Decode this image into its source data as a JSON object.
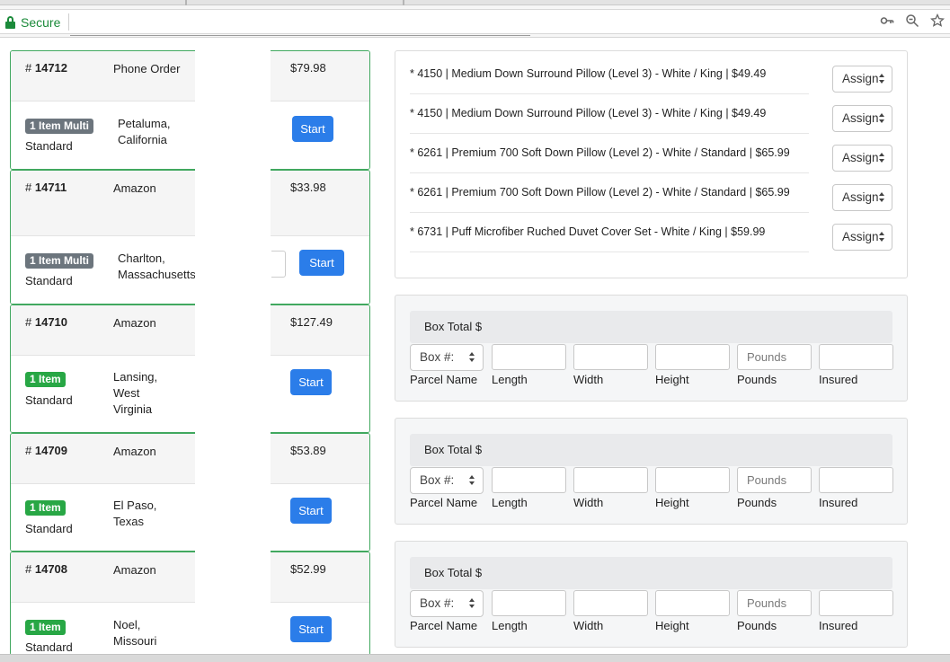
{
  "browser": {
    "secure_label": "Secure",
    "icons": [
      "key-icon",
      "zoom-icon",
      "star-icon"
    ]
  },
  "orders": [
    {
      "number": "14712",
      "channel": "Phone Order",
      "price": "$79.98",
      "badge": "1 Item Multi",
      "badge_kind": "multi",
      "ship": "Standard",
      "location": "Petaluma, California",
      "start": "Start"
    },
    {
      "number": "14711",
      "channel": "Amazon",
      "price": "$33.98",
      "badge": "1 Item Multi",
      "badge_kind": "multi",
      "ship": "Standard",
      "location": "Charlton, Massachusetts",
      "start": "Start"
    },
    {
      "number": "14710",
      "channel": "Amazon",
      "price": "$127.49",
      "badge": "1 Item",
      "badge_kind": "single",
      "ship": "Standard",
      "location": "Lansing, West Virginia",
      "start": "Start"
    },
    {
      "number": "14709",
      "channel": "Amazon",
      "price": "$53.89",
      "badge": "1 Item",
      "badge_kind": "single",
      "ship": "Standard",
      "location": "El Paso, Texas",
      "start": "Start"
    },
    {
      "number": "14708",
      "channel": "Amazon",
      "price": "$52.99",
      "badge": "1 Item",
      "badge_kind": "single",
      "ship": "Standard",
      "location": "Noel, Missouri",
      "start": "Start"
    }
  ],
  "order_number_prefix": "#",
  "items": [
    {
      "text": "* 4150 | Medium Down Surround Pillow (Level 3) - White / King | $49.49",
      "assign": "Assign"
    },
    {
      "text": "* 4150 | Medium Down Surround Pillow (Level 3) - White / King | $49.49",
      "assign": "Assign"
    },
    {
      "text": "* 6261 | Premium 700 Soft Down Pillow (Level 2) - White / Standard | $65.99",
      "assign": "Assign"
    },
    {
      "text": "* 6261 | Premium 700 Soft Down Pillow (Level 2) - White / Standard | $65.99",
      "assign": "Assign"
    },
    {
      "text": "* 6731 | Puff Microfiber Ruched Duvet Cover Set - White / King | $59.99",
      "assign": "Assign"
    }
  ],
  "box": {
    "total_label": "Box Total $",
    "box_select": "Box #:",
    "pounds_placeholder": "Pounds",
    "labels": {
      "parcel": "Parcel Name",
      "length": "Length",
      "width": "Width",
      "height": "Height",
      "pounds": "Pounds",
      "insured": "Insured"
    }
  },
  "colors": {
    "card_border": "#41a85f",
    "badge_multi": "#6c757d",
    "badge_single": "#28a745",
    "primary_button": "#2b7de9",
    "secure_green": "#1b8a3a"
  }
}
